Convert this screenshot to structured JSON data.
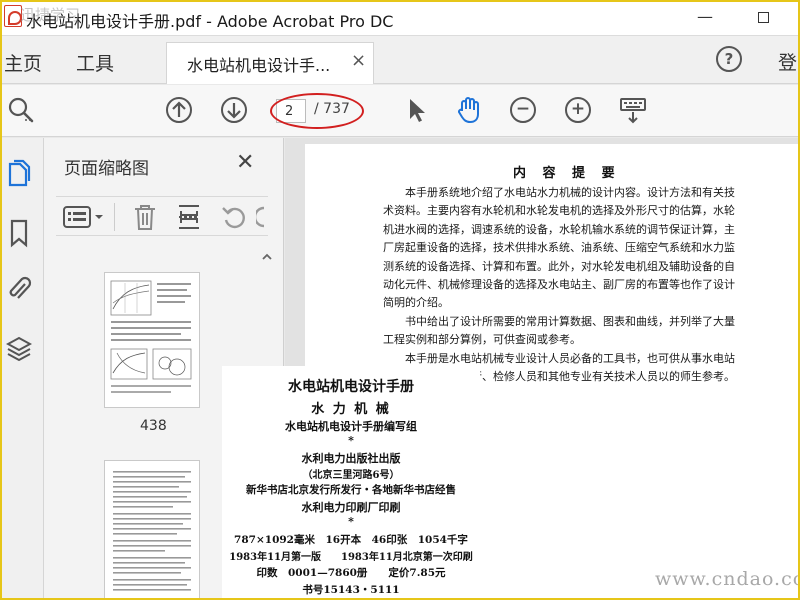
{
  "window": {
    "title": "水电站机电设计手册.pdf - Adobe Acrobat Pro DC",
    "minimize_glyph": "—"
  },
  "tabs": {
    "home_label": "主页",
    "tools_label": "工具",
    "document_tab_label": "水电站机电设计手...",
    "close_glyph": "×",
    "help_glyph": "?",
    "signin_label_partial": "登"
  },
  "toolbar": {
    "page_current": "2",
    "page_total": "/ 737",
    "zoom_out_glyph": "−",
    "zoom_in_glyph": "+",
    "highlight_color": "#d21f1f"
  },
  "icons": {
    "search": "magnifier-icon",
    "prev_page": "arrow-up-circle-icon",
    "next_page": "arrow-down-circle-icon",
    "select": "cursor-arrow-icon",
    "hand": "hand-icon",
    "zoom_out": "minus-circle-icon",
    "zoom_in": "plus-circle-icon",
    "keyboard": "keyboard-icon",
    "rail": [
      "pages-icon",
      "bookmark-icon",
      "attachment-icon",
      "layers-icon"
    ]
  },
  "thumbnails_panel": {
    "title": "页面缩略图",
    "close_glyph": "✕",
    "thumb_page_label": "438"
  },
  "page1": {
    "heading": "内 容 提 要",
    "paragraphs": [
      "本手册系统地介绍了水电站水力机械的设计内容。设计方法和有关技术资料。主要内容有水轮机和水轮发电机的选择及外形尺寸的估算，水轮机进水阀的选择，调速系统的设备，水轮机输水系统的调节保证计算，主厂房起重设备的选择，技术供排水系统、油系统、压缩空气系统和水力监测系统的设备选择、计算和布置。此外，对水轮发电机组及辅助设备的自动化元件、机械修理设备的选择及水电站主、副厂房的布置等也作了设计简明的介绍。",
      "书中给出了设计所需要的常用计算数据、图表和曲线，并列举了大量工程实例和部分算例，可供查阅或参考。",
      "本手册是水电站机械专业设计人员必备的工具书，也可供从事水电站机电设备安装、运行、检修人员和其他专业有关技术人员以的师生参考。"
    ]
  },
  "page2": {
    "title": "水电站机电设计手册",
    "subtitle": "水 力 机 械",
    "editor": "水电站机电设计手册编写组",
    "star1": "*",
    "publisher": "水利电力出版社出版",
    "address": "（北京三里河路6号）",
    "distribution": "新华书店北京发行所发行・各地新华书店经售",
    "printer": "水利电力印刷厂印刷",
    "star2": "*",
    "specs": "787×1092毫米　16开本　46印张　1054千字",
    "edition": "1983年11月第一版　　1983年11月北京第一次印刷",
    "print_run": "印数　0001—7860册　　定价7.85元",
    "book_number": "书号15143・5111"
  },
  "watermark": {
    "right": "www.cndao.com",
    "left": "迅捷学习"
  }
}
